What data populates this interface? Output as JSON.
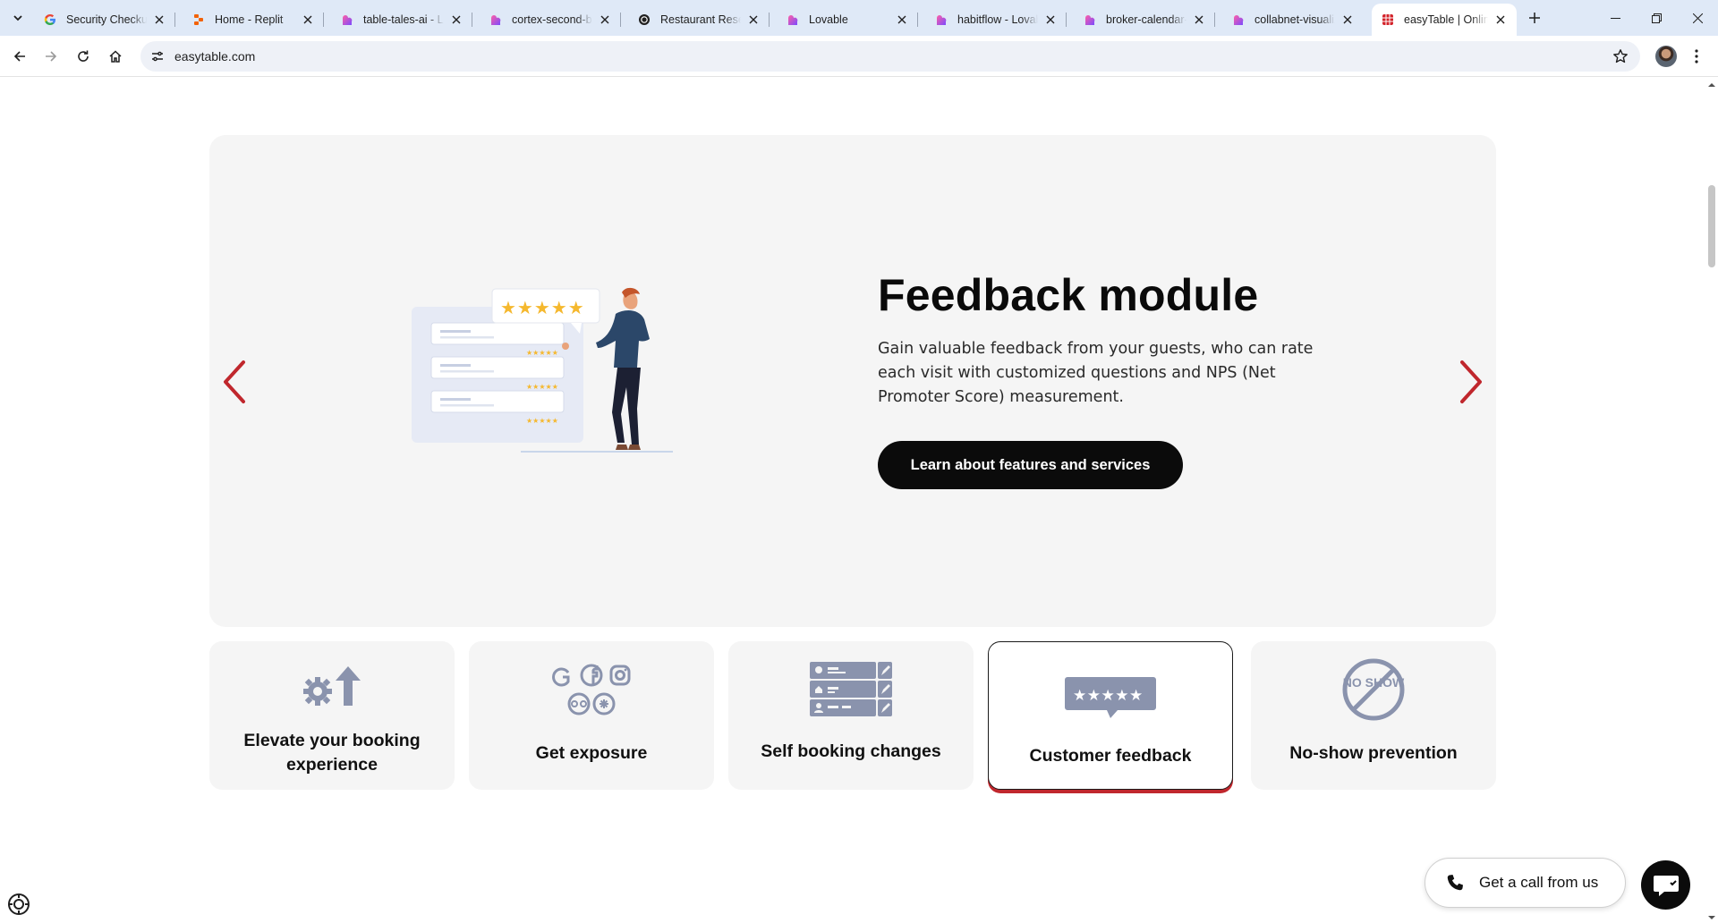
{
  "browser": {
    "tabs": [
      {
        "title": "Security Checkup",
        "icon": "google-icon"
      },
      {
        "title": "Home - Replit",
        "icon": "replit-icon"
      },
      {
        "title": "table-tales-ai - Lovable",
        "icon": "lovable-icon"
      },
      {
        "title": "cortex-second-brain - Lovable",
        "icon": "lovable-icon"
      },
      {
        "title": "Restaurant Reservation",
        "icon": "openai-icon"
      },
      {
        "title": "Lovable",
        "icon": "lovable-icon"
      },
      {
        "title": "habitflow - Lovable",
        "icon": "lovable-icon"
      },
      {
        "title": "broker-calendar-view - Lovable",
        "icon": "lovable-icon"
      },
      {
        "title": "collabnet-visualizer - Lovable",
        "icon": "lovable-icon"
      },
      {
        "title": "easyTable | Online booking",
        "icon": "easytable-icon",
        "active": true
      }
    ],
    "url": "easytable.com"
  },
  "hero": {
    "title": "Feedback module",
    "description": "Gain valuable feedback from your guests, who can rate each visit with customized questions and NPS (Net Promoter Score) measurement.",
    "cta_label": "Learn about features and services",
    "rating_stars": 5
  },
  "features": [
    {
      "label": "Elevate your booking experience",
      "icon": "gear-arrow-up-icon"
    },
    {
      "label": "Get exposure",
      "icon": "social-networks-icon"
    },
    {
      "label": "Self booking changes",
      "icon": "booking-list-edit-icon"
    },
    {
      "label": "Customer feedback",
      "icon": "rating-bubble-icon",
      "active": true
    },
    {
      "label": "No-show prevention",
      "icon": "no-show-icon",
      "badge_text": "NO SHOW"
    }
  ],
  "floating": {
    "call_label": "Get a call from us",
    "chat_icon": "chat-icon"
  },
  "colors": {
    "accent_red": "#c0272d",
    "cta_black": "#0b0b0b",
    "icon_slate": "#8a93ad",
    "star_gold": "#f5b82e"
  }
}
